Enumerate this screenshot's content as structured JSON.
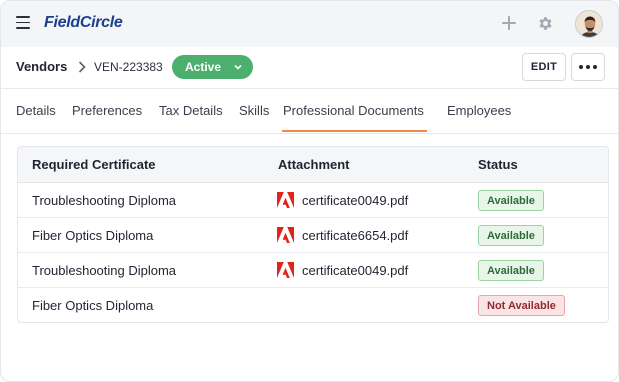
{
  "app": {
    "logo_text": "FieldCircle",
    "brand_color": "#1c3f8f",
    "accent_color": "#f08a4b"
  },
  "topbar": {
    "icons": [
      "menu-icon",
      "plus-icon",
      "gear-icon",
      "avatar"
    ]
  },
  "header": {
    "breadcrumb_root": "Vendors",
    "record_id": "VEN-223383",
    "status_label": "Active",
    "status_color": "#4caf6e",
    "edit_label": "EDIT"
  },
  "tabs": [
    {
      "label": "Details",
      "active": false
    },
    {
      "label": "Preferences",
      "active": false
    },
    {
      "label": "Tax Details",
      "active": false
    },
    {
      "label": "Skills",
      "active": false
    },
    {
      "label": "Professional Documents",
      "active": true
    },
    {
      "label": "Employees",
      "active": false
    }
  ],
  "table": {
    "columns": [
      "Required Certificate",
      "Attachment",
      "Status"
    ],
    "rows": [
      {
        "certificate": "Troubleshooting Diploma",
        "attachment": "certificate0049.pdf",
        "status": "Available"
      },
      {
        "certificate": "Fiber Optics Diploma",
        "attachment": "certificate6654.pdf",
        "status": "Available"
      },
      {
        "certificate": "Troubleshooting Diploma",
        "attachment": "certificate0049.pdf",
        "status": "Available"
      },
      {
        "certificate": "Fiber Optics Diploma",
        "attachment": "",
        "status": "Not Available"
      }
    ]
  }
}
